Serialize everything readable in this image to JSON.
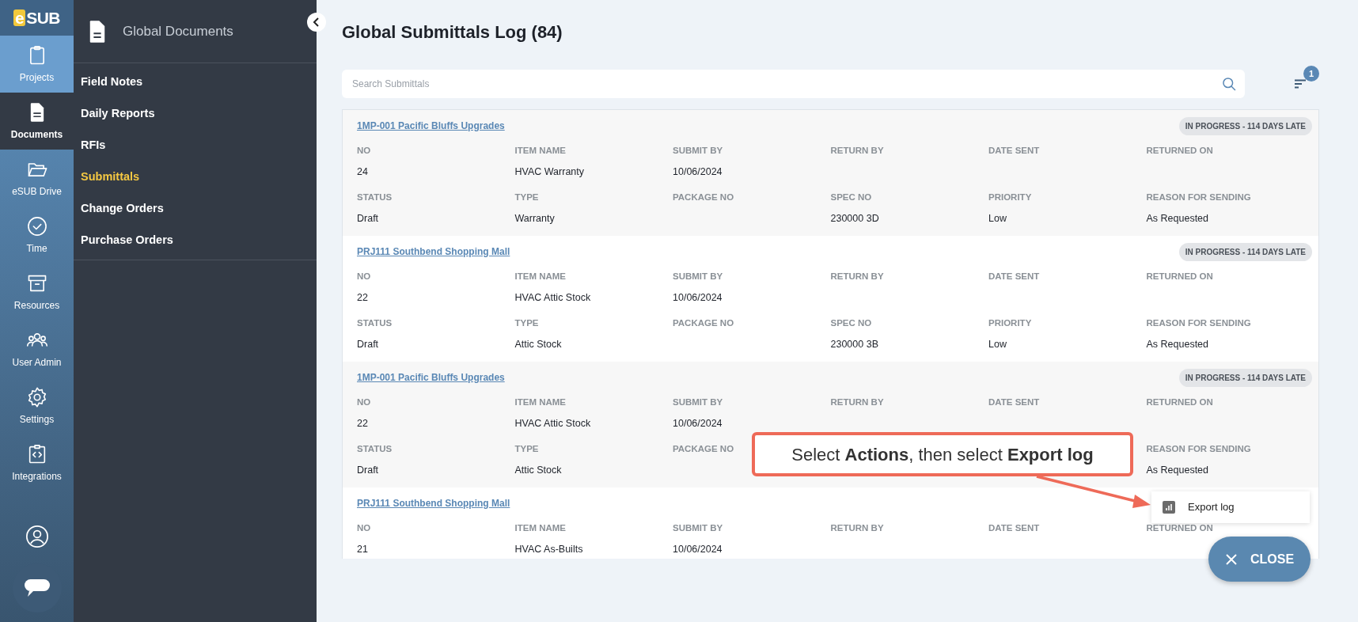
{
  "rail": {
    "logo": "eSUB",
    "items": [
      {
        "label": "Projects",
        "selected": false,
        "hovered": true
      },
      {
        "label": "Documents",
        "selected": true,
        "hovered": false
      },
      {
        "label": "eSUB Drive",
        "selected": false,
        "hovered": false
      },
      {
        "label": "Time",
        "selected": false,
        "hovered": false
      },
      {
        "label": "Resources",
        "selected": false,
        "hovered": false
      },
      {
        "label": "User Admin",
        "selected": false,
        "hovered": false
      },
      {
        "label": "Settings",
        "selected": false,
        "hovered": false
      },
      {
        "label": "Integrations",
        "selected": false,
        "hovered": false
      }
    ]
  },
  "sidebar": {
    "title": "Global Documents",
    "items": [
      {
        "label": "Field Notes",
        "selected": false
      },
      {
        "label": "Daily Reports",
        "selected": false
      },
      {
        "label": "RFIs",
        "selected": false
      },
      {
        "label": "Submittals",
        "selected": true
      },
      {
        "label": "Change Orders",
        "selected": false
      },
      {
        "label": "Purchase Orders",
        "selected": false
      }
    ]
  },
  "page_title": "Global Submittals Log (84)",
  "search": {
    "placeholder": "Search Submittals"
  },
  "filter": {
    "badge": "1"
  },
  "cards": [
    {
      "title": "1MP-001 Pacific Bluffs Upgrades",
      "badge": "IN PROGRESS - 114 DAYS LATE",
      "rows": [
        [
          {
            "label": "NO",
            "value": "24"
          },
          {
            "label": "ITEM NAME",
            "value": "HVAC Warranty"
          },
          {
            "label": "SUBMIT BY",
            "value": "10/06/2024"
          },
          {
            "label": "RETURN BY"
          },
          {
            "label": "DATE SENT"
          },
          {
            "label": "RETURNED ON"
          }
        ],
        [
          {
            "label": "STATUS",
            "value": "Draft"
          },
          {
            "label": "TYPE",
            "value": "Warranty"
          },
          {
            "label": "PACKAGE NO"
          },
          {
            "label": "SPEC NO",
            "value": "230000 3D"
          },
          {
            "label": "PRIORITY",
            "value": "Low"
          },
          {
            "label": "REASON FOR SENDING",
            "value": "As Requested"
          }
        ]
      ]
    },
    {
      "title": "PRJ111 Southbend Shopping Mall",
      "badge": "IN PROGRESS - 114 DAYS LATE",
      "rows": [
        [
          {
            "label": "NO",
            "value": "22"
          },
          {
            "label": "ITEM NAME",
            "value": "HVAC Attic Stock"
          },
          {
            "label": "SUBMIT BY",
            "value": "10/06/2024"
          },
          {
            "label": "RETURN BY"
          },
          {
            "label": "DATE SENT"
          },
          {
            "label": "RETURNED ON"
          }
        ],
        [
          {
            "label": "STATUS",
            "value": "Draft"
          },
          {
            "label": "TYPE",
            "value": "Attic Stock"
          },
          {
            "label": "PACKAGE NO"
          },
          {
            "label": "SPEC NO",
            "value": "230000 3B"
          },
          {
            "label": "PRIORITY",
            "value": "Low"
          },
          {
            "label": "REASON FOR SENDING",
            "value": "As Requested"
          }
        ]
      ]
    },
    {
      "title": "1MP-001 Pacific Bluffs Upgrades",
      "badge": "IN PROGRESS - 114 DAYS LATE",
      "rows": [
        [
          {
            "label": "NO",
            "value": "22"
          },
          {
            "label": "ITEM NAME",
            "value": "HVAC Attic Stock"
          },
          {
            "label": "SUBMIT BY",
            "value": "10/06/2024"
          },
          {
            "label": "RETURN BY"
          },
          {
            "label": "DATE SENT"
          },
          {
            "label": "RETURNED ON"
          }
        ],
        [
          {
            "label": "STATUS",
            "value": "Draft"
          },
          {
            "label": "TYPE",
            "value": "Attic Stock"
          },
          {
            "label": "PACKAGE NO"
          },
          {},
          {},
          {
            "label": "REASON FOR SENDING",
            "value": "As Requested"
          }
        ]
      ]
    },
    {
      "title": "PRJ111 Southbend Shopping Mall",
      "rows": [
        [
          {
            "label": "NO",
            "value": "21"
          },
          {
            "label": "ITEM NAME",
            "value": "HVAC As-Builts"
          },
          {
            "label": "SUBMIT BY",
            "value": "10/06/2024"
          },
          {
            "label": "RETURN BY"
          },
          {
            "label": "DATE SENT"
          },
          {
            "label": "RETURNED ON"
          }
        ]
      ]
    }
  ],
  "callout": "Select **Actions**, then select **Export log**",
  "menu": {
    "items": [
      "Export log"
    ]
  },
  "close_button": "CLOSE"
}
